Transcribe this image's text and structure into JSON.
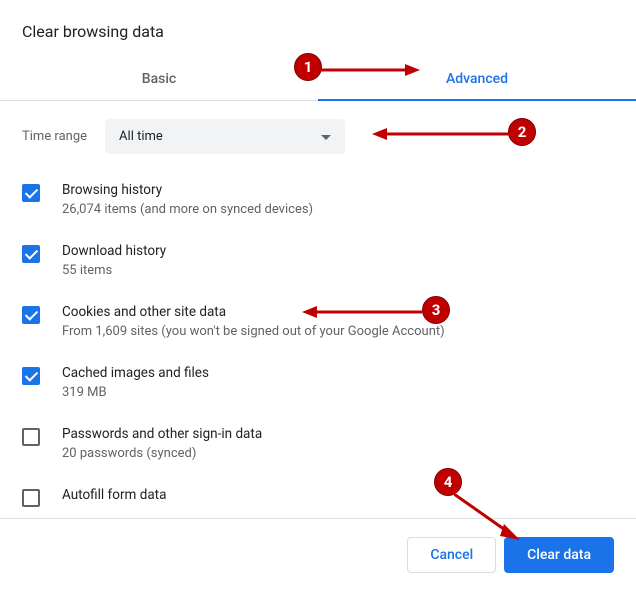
{
  "title": "Clear browsing data",
  "tabs": {
    "basic": "Basic",
    "advanced": "Advanced"
  },
  "time": {
    "label": "Time range",
    "value": "All time"
  },
  "items": [
    {
      "checked": true,
      "title": "Browsing history",
      "sub": "26,074 items (and more on synced devices)"
    },
    {
      "checked": true,
      "title": "Download history",
      "sub": "55 items"
    },
    {
      "checked": true,
      "title": "Cookies and other site data",
      "sub": "From 1,609 sites (you won't be signed out of your Google Account)"
    },
    {
      "checked": true,
      "title": "Cached images and files",
      "sub": "319 MB"
    },
    {
      "checked": false,
      "title": "Passwords and other sign-in data",
      "sub": "20 passwords (synced)"
    },
    {
      "checked": false,
      "title": "Autofill form data",
      "sub": ""
    }
  ],
  "footer": {
    "cancel": "Cancel",
    "clear": "Clear data"
  },
  "annotations": {
    "n1": "1",
    "n2": "2",
    "n3": "3",
    "n4": "4"
  }
}
